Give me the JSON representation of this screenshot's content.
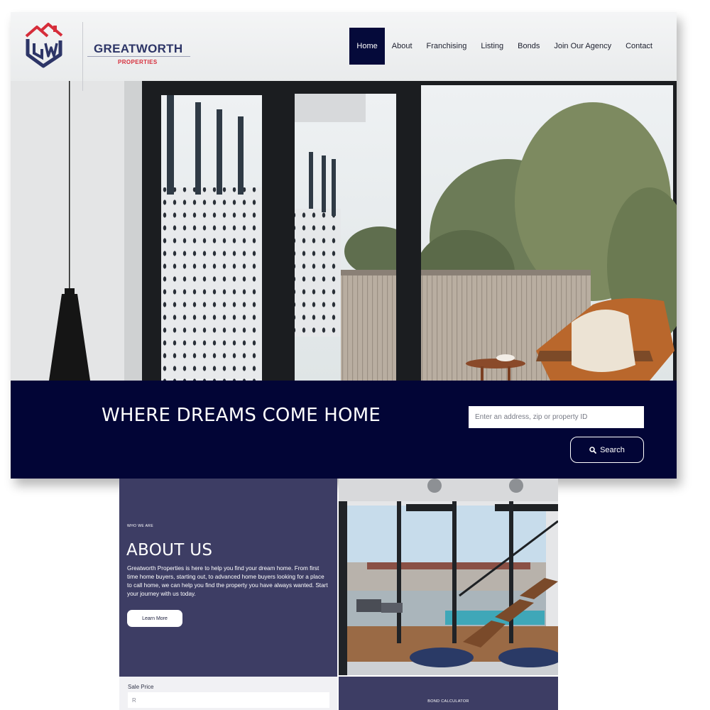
{
  "brand": {
    "name": "GREATWORTH",
    "sub": "PROPERTIES",
    "colors": {
      "navy": "#2d3567",
      "red": "#d62d3a"
    }
  },
  "nav": {
    "items": [
      "Home",
      "About",
      "Franchising",
      "Listing",
      "Bonds",
      "Join Our Agency",
      "Contact"
    ],
    "active": "Home"
  },
  "hero": {
    "tagline": "WHERE DREAMS COME HOME",
    "search_placeholder": "Enter an address, zip or property ID",
    "search_button": "Search",
    "search_icon": "search-icon"
  },
  "about": {
    "eyebrow": "WHO WE ARE",
    "title": "ABOUT US",
    "text": "Greatworth Properties is here to help you find your dream home. From first time home buyers, starting out, to advanced home buyers looking for a place to call home, we can help you find the property you have always wanted. Start your journey with us today.",
    "button": "Learn More"
  },
  "calculator": {
    "sale_price_label": "Sale Price",
    "sale_price_placeholder": "R",
    "title": "BOND CALCULATOR"
  },
  "theme": {
    "nav_active_bg": "#050a3a",
    "banner_bg": "#020536",
    "panel_bg": "#3d3d64"
  }
}
